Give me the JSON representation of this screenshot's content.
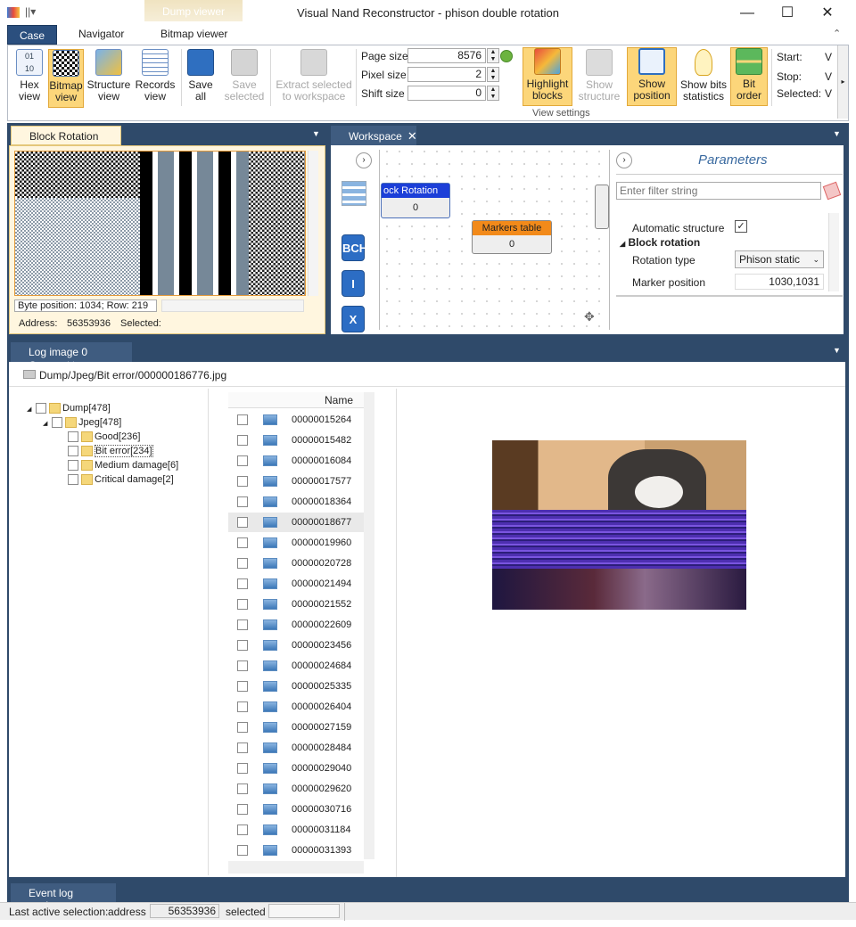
{
  "window": {
    "title": "Visual Nand Reconstructor - phison double rotation",
    "context_tab": "Dump viewer"
  },
  "ribbon_tabs": [
    "Case",
    "Navigator",
    "Bitmap viewer"
  ],
  "ribbon": {
    "hex_view": "Hex view",
    "bitmap_view": "Bitmap view",
    "structure_view": "Structure view",
    "records_view": "Records view",
    "save_all": "Save all",
    "save_selected": "Save selected",
    "extract_selected": "Extract selected to workspace",
    "page_size_label": "Page size",
    "page_size": "8576",
    "pixel_size_label": "Pixel size",
    "pixel_size": "2",
    "shift_size_label": "Shift size",
    "shift_size": "0",
    "highlight_blocks": "Highlight blocks",
    "show_structure": "Show structure",
    "show_position": "Show position",
    "show_bits_statistics": "Show bits statistics",
    "bit_order": "Bit order",
    "view_settings": "View settings",
    "start_label": "Start:",
    "stop_label": "Stop:",
    "selected_label": "Selected:",
    "v": "V"
  },
  "block_panel": {
    "tab": "Block Rotation 0",
    "byte_position": "Byte position: 1034; Row: 219",
    "address_label": "Address:",
    "address": "56353936",
    "selected_label": "Selected:"
  },
  "workspace": {
    "tab": "Workspace",
    "node1_title": "ock Rotation",
    "node1_value": "0",
    "node2_title": "Markers table",
    "node2_value": "0",
    "btn_bch": "BCH",
    "btn_i": "I",
    "btn_x": "X"
  },
  "parameters": {
    "title": "Parameters",
    "filter_placeholder": "Enter filter string",
    "auto_structure": "Automatic structure",
    "block_rotation": "Block rotation",
    "rotation_type_label": "Rotation type",
    "rotation_type": "Phison static",
    "marker_position_label": "Marker position",
    "marker_position": "1030,1031"
  },
  "carver": {
    "tab": "Log image 0 Carver",
    "path": "Dump/Jpeg/Bit error/000000186776.jpg",
    "tree": [
      {
        "label": "Dump[478]",
        "indent": 0
      },
      {
        "label": "Jpeg[478]",
        "indent": 1
      },
      {
        "label": "Good[236]",
        "indent": 2
      },
      {
        "label": "Bit error[234]",
        "indent": 2
      },
      {
        "label": "Medium damage[6]",
        "indent": 2
      },
      {
        "label": "Critical damage[2]",
        "indent": 2
      }
    ],
    "name_header": "Name",
    "files": [
      "00000015264",
      "00000015482",
      "00000016084",
      "00000017577",
      "00000018364",
      "00000018677",
      "00000019960",
      "00000020728",
      "00000021494",
      "00000021552",
      "00000022609",
      "00000023456",
      "00000024684",
      "00000025335",
      "00000026404",
      "00000027159",
      "00000028484",
      "00000029040",
      "00000029620",
      "00000030716",
      "00000031184",
      "00000031393"
    ]
  },
  "event_log": {
    "tab": "Event log explorer"
  },
  "status": {
    "last_active": "Last active selection:",
    "address_label": "address",
    "address": "56353936",
    "selected_label": "selected"
  }
}
